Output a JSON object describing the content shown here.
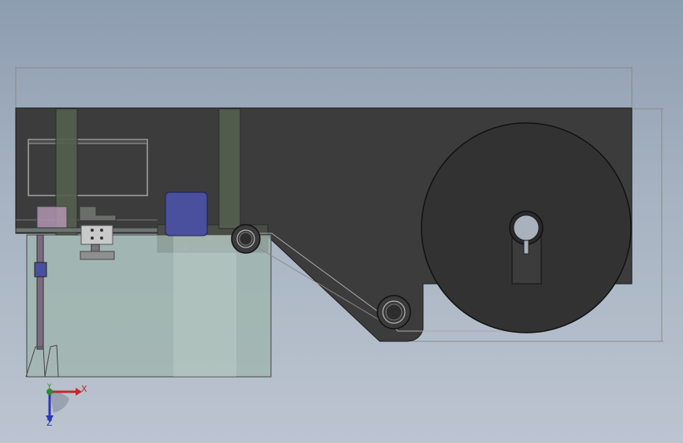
{
  "scene": {
    "colors": {
      "background_top": "#8d9db0",
      "background_bottom": "#bcc4d0",
      "frame_plate": "#3c3c3c",
      "transparent_guard": "#9fb5ad",
      "post": "#55604f",
      "roller_body": "#323232",
      "blue_block": "#4a4f9e",
      "pink_block": "#b89ab8",
      "dimension_line": "#8a8a8a"
    },
    "triad": {
      "x_label": "X",
      "y_label": "Y",
      "z_label": "Z",
      "x_color": "#c4282a",
      "y_color": "#2f8a2f",
      "z_color": "#2a36b8"
    }
  }
}
